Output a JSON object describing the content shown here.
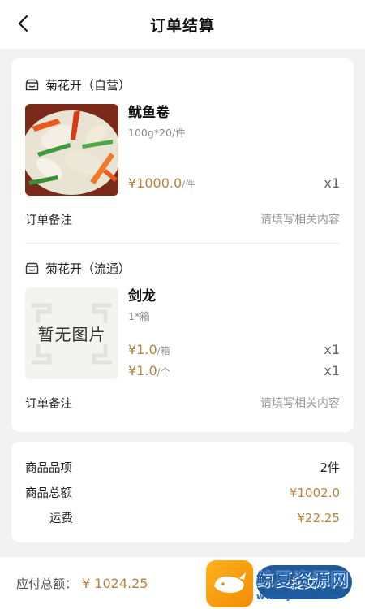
{
  "header": {
    "title": "订单结算"
  },
  "stores": [
    {
      "name": "菊花开（自营）",
      "goods": {
        "name": "鱿鱼卷",
        "spec": "100g*20/件",
        "prices": [
          {
            "price": "¥1000.0",
            "unit": "/件",
            "qty": "x1"
          }
        ]
      },
      "remark_label": "订单备注",
      "remark_placeholder": "请填写相关内容"
    },
    {
      "name": "菊花开（流通）",
      "goods": {
        "name": "剑龙",
        "spec": "1*箱",
        "no_image_text": "暂无图片",
        "prices": [
          {
            "price": "¥1.0",
            "unit": "/箱",
            "qty": "x1"
          },
          {
            "price": "¥1.0",
            "unit": "/个",
            "qty": "x1"
          }
        ]
      },
      "remark_label": "订单备注",
      "remark_placeholder": "请填写相关内容"
    }
  ],
  "summary": {
    "items_label": "商品品项",
    "items_value": "2件",
    "amount_label": "商品总额",
    "amount_value": "¥1002.0",
    "freight_label": "运费",
    "freight_value": "¥22.25"
  },
  "footer": {
    "total_label": "应付总额：",
    "total_value": "¥ 1024.25",
    "submit_label": "提交"
  },
  "watermark": {
    "name": "鲸夏资源网",
    "url": "www.j323.com"
  },
  "colors": {
    "accent": "#b9833e",
    "brand_blue": "#1f5a9b"
  },
  "icons": {
    "back": "chevron-left-icon",
    "store": "store-icon"
  }
}
